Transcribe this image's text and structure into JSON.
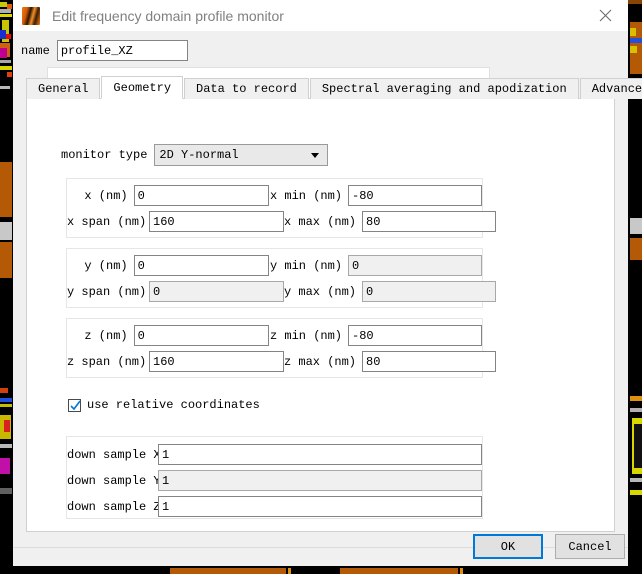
{
  "window": {
    "title": "Edit frequency domain profile monitor",
    "icon": "lumerical-wave-icon",
    "close_icon": "close-icon"
  },
  "name_field": {
    "label": "name",
    "value": "profile_XZ",
    "placeholder": ""
  },
  "tabs": [
    {
      "label": "General",
      "active": false
    },
    {
      "label": "Geometry",
      "active": true
    },
    {
      "label": "Data to record",
      "active": false
    },
    {
      "label": "Spectral averaging and apodization",
      "active": false
    },
    {
      "label": "Advanced",
      "active": false
    }
  ],
  "geometry": {
    "monitor_type": {
      "label": "monitor type",
      "value": "2D Y-normal",
      "dropdown_icon": "chevron-down-icon"
    },
    "groups": [
      {
        "id": "x",
        "rows": [
          {
            "label_a": "x (nm)",
            "value_a": "0",
            "disabled_a": false,
            "label_b": "x min (nm)",
            "value_b": "-80",
            "disabled_b": false
          },
          {
            "label_a": "x span (nm)",
            "value_a": "160",
            "disabled_a": false,
            "label_b": "x max (nm)",
            "value_b": "80",
            "disabled_b": false
          }
        ]
      },
      {
        "id": "y",
        "rows": [
          {
            "label_a": "y (nm)",
            "value_a": "0",
            "disabled_a": false,
            "label_b": "y min (nm)",
            "value_b": "0",
            "disabled_b": true
          },
          {
            "label_a": "y span (nm)",
            "value_a": "0",
            "disabled_a": true,
            "label_b": "y max (nm)",
            "value_b": "0",
            "disabled_b": true
          }
        ]
      },
      {
        "id": "z",
        "rows": [
          {
            "label_a": "z (nm)",
            "value_a": "0",
            "disabled_a": false,
            "label_b": "z min (nm)",
            "value_b": "-80",
            "disabled_b": false
          },
          {
            "label_a": "z span (nm)",
            "value_a": "160",
            "disabled_a": false,
            "label_b": "z max (nm)",
            "value_b": "80",
            "disabled_b": false
          }
        ]
      }
    ],
    "use_relative_coordinates": {
      "label": "use relative coordinates",
      "checked": true
    },
    "down_sample": [
      {
        "label": "down sample X",
        "value": "1",
        "disabled": false
      },
      {
        "label": "down sample Y",
        "value": "1",
        "disabled": true
      },
      {
        "label": "down sample Z",
        "value": "1",
        "disabled": false
      }
    ]
  },
  "footer": {
    "ok_label": "OK",
    "cancel_label": "Cancel"
  },
  "colors": {
    "accent": "#0078d7",
    "title_text": "#808080",
    "dialog_bg": "#f0f0f0",
    "panel_bg": "#ffffff",
    "disabled_field_bg": "#f0f0f0"
  }
}
